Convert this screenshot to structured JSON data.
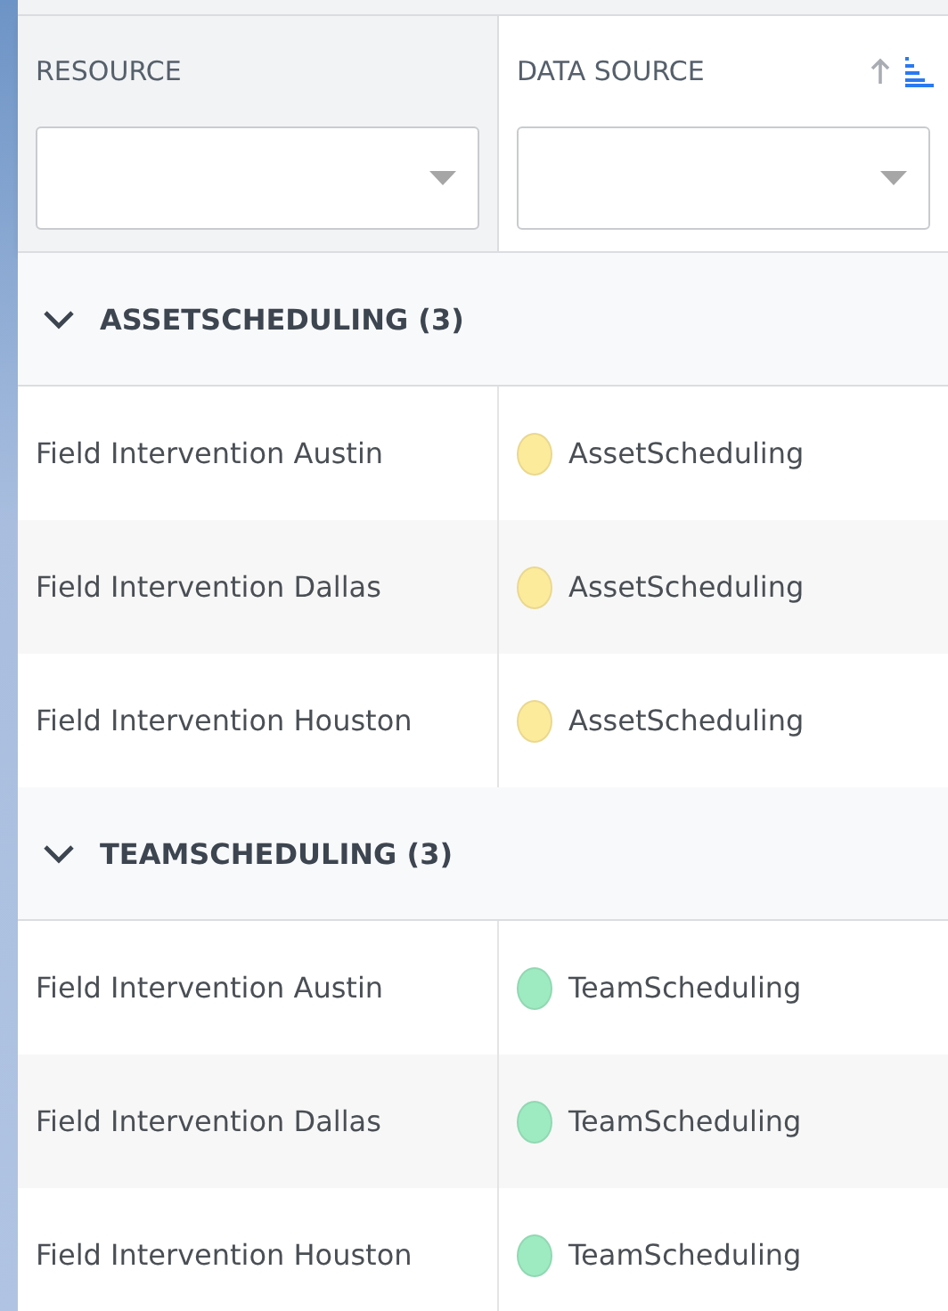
{
  "columns": [
    {
      "label": "RESOURCE",
      "sorted": false
    },
    {
      "label": "DATA SOURCE",
      "sorted": true
    }
  ],
  "groups": [
    {
      "label": "ASSETSCHEDULING (3)",
      "expanded": true,
      "rows": [
        {
          "resource": "Field Intervention Austin",
          "source": "AssetScheduling",
          "color": "#fdeb9c"
        },
        {
          "resource": "Field Intervention Dallas",
          "source": "AssetScheduling",
          "color": "#fdeb9c"
        },
        {
          "resource": "Field Intervention Houston",
          "source": "AssetScheduling",
          "color": "#fdeb9c"
        }
      ]
    },
    {
      "label": "TEAMSCHEDULING (3)",
      "expanded": true,
      "rows": [
        {
          "resource": "Field Intervention Austin",
          "source": "TeamScheduling",
          "color": "#9eebc2"
        },
        {
          "resource": "Field Intervention Dallas",
          "source": "TeamScheduling",
          "color": "#9eebc2"
        },
        {
          "resource": "Field Intervention Houston",
          "source": "TeamScheduling",
          "color": "#9eebc2"
        }
      ]
    }
  ]
}
